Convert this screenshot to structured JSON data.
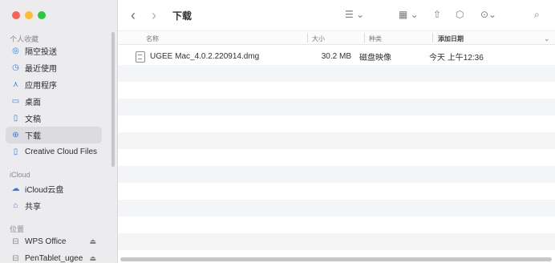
{
  "sidebar": {
    "sections": [
      {
        "label": "个人收藏"
      },
      {
        "label": "iCloud"
      },
      {
        "label": "位置"
      }
    ],
    "items": [
      {
        "label": "隔空投送",
        "icon": "airdrop-icon"
      },
      {
        "label": "最近使用",
        "icon": "clock-icon"
      },
      {
        "label": "应用程序",
        "icon": "apps-icon"
      },
      {
        "label": "桌面",
        "icon": "desktop-icon"
      },
      {
        "label": "文稿",
        "icon": "document-icon"
      },
      {
        "label": "下载",
        "icon": "download-icon"
      },
      {
        "label": "Creative Cloud Files",
        "icon": "folder-icon"
      },
      {
        "label": "iCloud云盘",
        "icon": "cloud-icon"
      },
      {
        "label": "共享",
        "icon": "shared-icon"
      },
      {
        "label": "WPS Office",
        "icon": "drive-icon"
      },
      {
        "label": "PenTablet_ugee",
        "icon": "drive-icon"
      }
    ]
  },
  "toolbar": {
    "title": "下载"
  },
  "table": {
    "headers": [
      "名称",
      "大小",
      "种类",
      "添加日期"
    ],
    "rows": [
      {
        "name": "UGEE Mac_4.0.2.220914.dmg",
        "size": "30.2 MB",
        "kind": "磁盘映像",
        "date": "今天 上午12:36"
      }
    ]
  }
}
